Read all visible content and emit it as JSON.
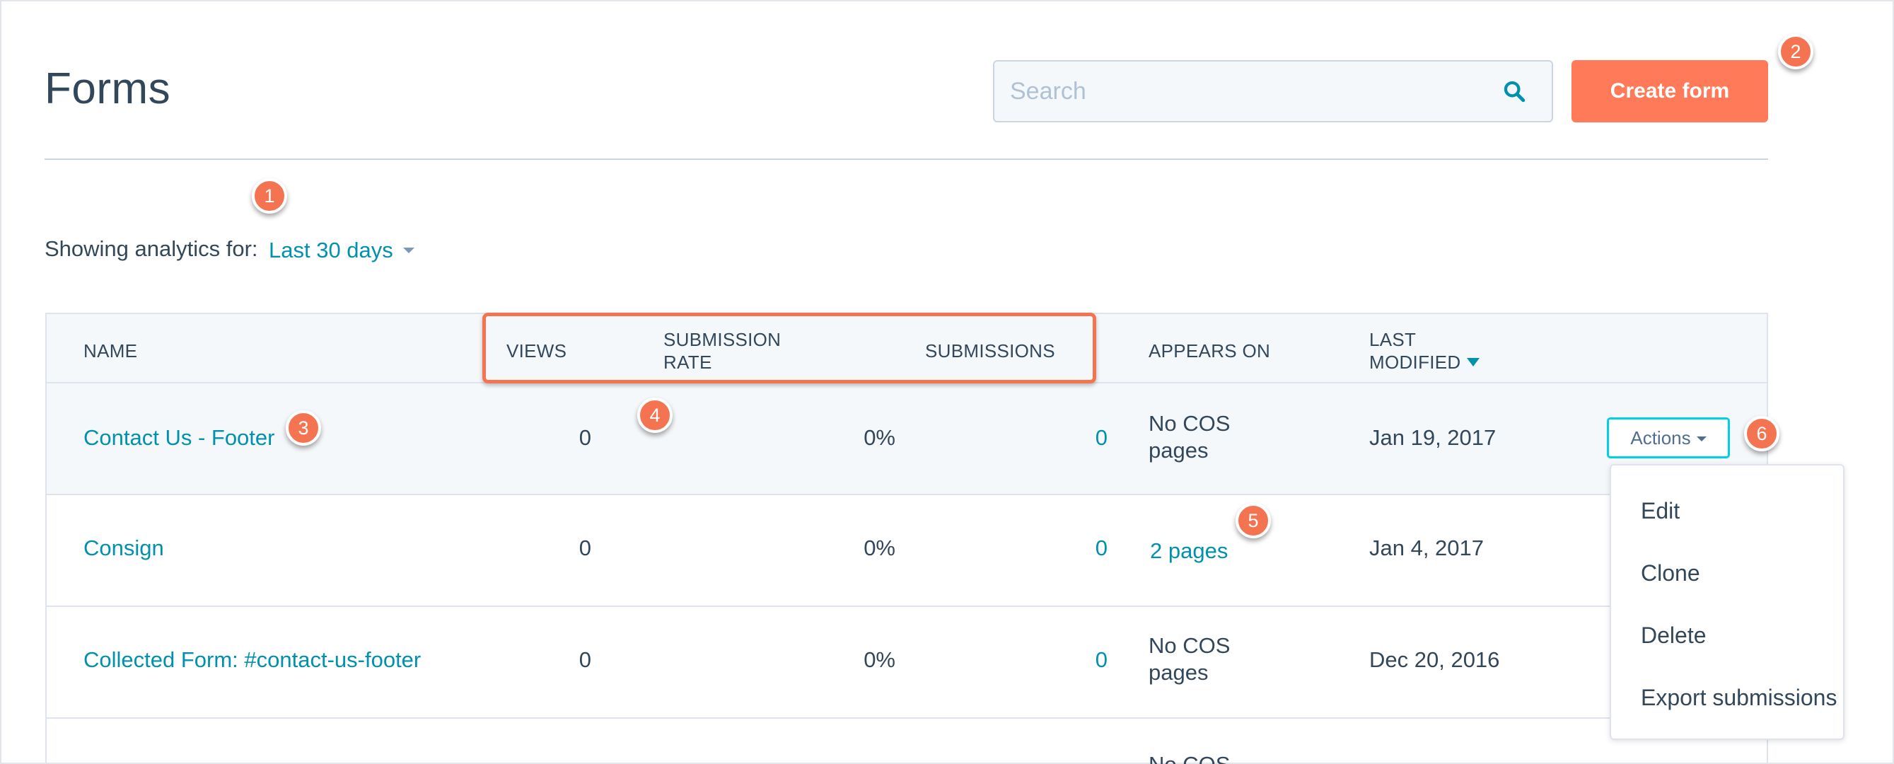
{
  "page": {
    "title": "Forms"
  },
  "search": {
    "placeholder": "Search",
    "value": ""
  },
  "create_button": {
    "label": "Create form"
  },
  "analytics": {
    "label": "Showing analytics for:",
    "range": "Last 30 days"
  },
  "table": {
    "columns": {
      "name": "NAME",
      "views": "VIEWS",
      "submission_rate_line1": "SUBMISSION",
      "submission_rate_line2": "RATE",
      "submissions": "SUBMISSIONS",
      "appears_on": "APPEARS ON",
      "last_modified_line1": "LAST",
      "last_modified_line2": "MODIFIED"
    },
    "rows": [
      {
        "name": "Contact Us - Footer",
        "views": "0",
        "rate": "0%",
        "submissions": "0",
        "appears_on_line1": "No COS",
        "appears_on_line2": "pages",
        "modified": "Jan 19, 2017"
      },
      {
        "name": "Consign",
        "views": "0",
        "rate": "0%",
        "submissions": "0",
        "appears_on_link": "2 pages",
        "modified": "Jan 4, 2017"
      },
      {
        "name": "Collected Form: #contact-us-footer",
        "views": "0",
        "rate": "0%",
        "submissions": "0",
        "appears_on_line1": "No COS",
        "appears_on_line2": "pages",
        "modified": "Dec 20, 2016"
      },
      {
        "appears_on_line1": "No COS"
      }
    ]
  },
  "actions": {
    "label": "Actions",
    "menu": [
      "Edit",
      "Clone",
      "Delete",
      "Export submissions"
    ]
  },
  "callouts": [
    "1",
    "2",
    "3",
    "4",
    "5",
    "6"
  ],
  "colors": {
    "accent": "#ff7a59",
    "link": "#0091ae",
    "callout": "#f47452",
    "focus": "#00d0e4"
  },
  "icons": {
    "search": "search-icon",
    "sort": "sort-desc-caret-icon",
    "dropdown": "caret-down-icon"
  }
}
